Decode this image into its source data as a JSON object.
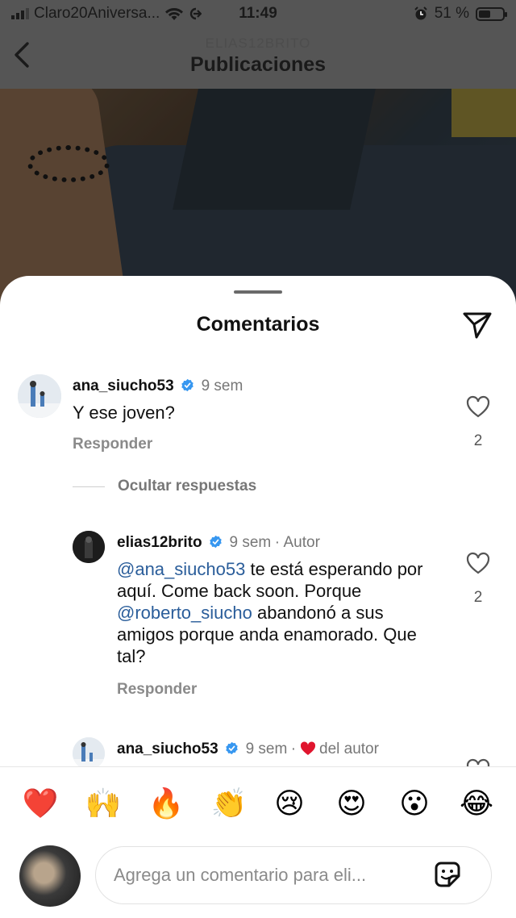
{
  "status_bar": {
    "carrier": "Claro20Aniversa...",
    "time": "11:49",
    "battery": "51 %",
    "battery_level": 0.51
  },
  "header": {
    "username": "ELIAS12BRITO",
    "title": "Publicaciones"
  },
  "sheet": {
    "title": "Comentarios"
  },
  "comments": [
    {
      "username": "ana_siucho53",
      "time": "9 sem",
      "text": "Y ese joven?",
      "reply_label": "Responder",
      "likes": "2"
    }
  ],
  "hide_replies_label": "Ocultar respuestas",
  "replies": [
    {
      "username": "elias12brito",
      "time": "9 sem",
      "separator": "·",
      "author_label": "Autor",
      "mention1": "@ana_siucho53",
      "text1": " te está esperando por aquí. Come back soon. Porque ",
      "mention2": "@roberto_siucho",
      "text2": " abandonó a sus amigos porque anda enamorado. Que tal?",
      "reply_label": "Responder",
      "likes": "2"
    },
    {
      "username": "ana_siucho53",
      "time": "9 sem",
      "separator": "·",
      "liked_by_author": "del autor"
    }
  ],
  "emoji_bar": [
    "❤️",
    "🙌",
    "🔥",
    "👏",
    "😢",
    "😍",
    "😮",
    "😂"
  ],
  "composer": {
    "placeholder": "Agrega un comentario para eli..."
  },
  "colors": {
    "mention": "#2a5d9a",
    "verified": "#3797f0",
    "heart_red": "#e0152e"
  }
}
